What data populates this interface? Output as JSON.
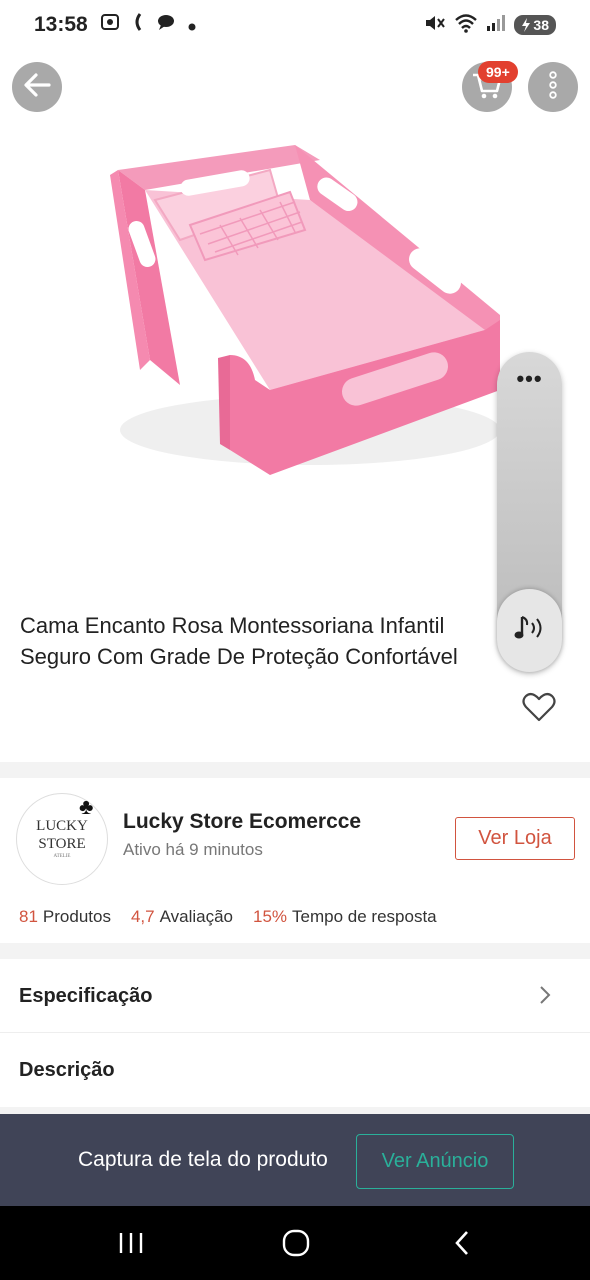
{
  "status_bar": {
    "time": "13:58",
    "battery": "38",
    "icons": [
      "screenshot-icon",
      "call-icon",
      "chat-bubble-icon",
      "dot-icon",
      "mute-icon",
      "wifi-icon",
      "signal-icon",
      "battery-icon"
    ]
  },
  "header": {
    "cart_badge": "99+",
    "icons": [
      "back-arrow-icon",
      "cart-icon",
      "more-vertical-icon"
    ]
  },
  "product": {
    "title_line1": "Cama Encanto Rosa Montessoriana Infantil",
    "title_line2": "Seguro Com Grade De Proteção Confortável"
  },
  "floating_widget": {
    "menu_label": "•••",
    "icon": "music-note-icon"
  },
  "store": {
    "logo_line1": "LUCKY",
    "logo_line2": "STORE",
    "logo_tagline": "ATELIE",
    "name": "Lucky Store Ecomercce",
    "active": "Ativo há 9 minutos",
    "button_label": "Ver Loja",
    "stats": [
      {
        "value": "81",
        "label": "Produtos"
      },
      {
        "value": "4,7",
        "label": "Avaliação"
      },
      {
        "value": "15%",
        "label": "Tempo de resposta"
      }
    ]
  },
  "rows": {
    "spec": "Especificação",
    "desc": "Descrição"
  },
  "banner": {
    "text": "Captura de tela do produto",
    "button_label": "Ver Anúncio"
  },
  "colors": {
    "accent": "#d1543f",
    "badge": "#e2402f",
    "banner_bg": "#404457",
    "banner_btn": "#2ab09a",
    "bed_pink": "#f27aa4"
  }
}
